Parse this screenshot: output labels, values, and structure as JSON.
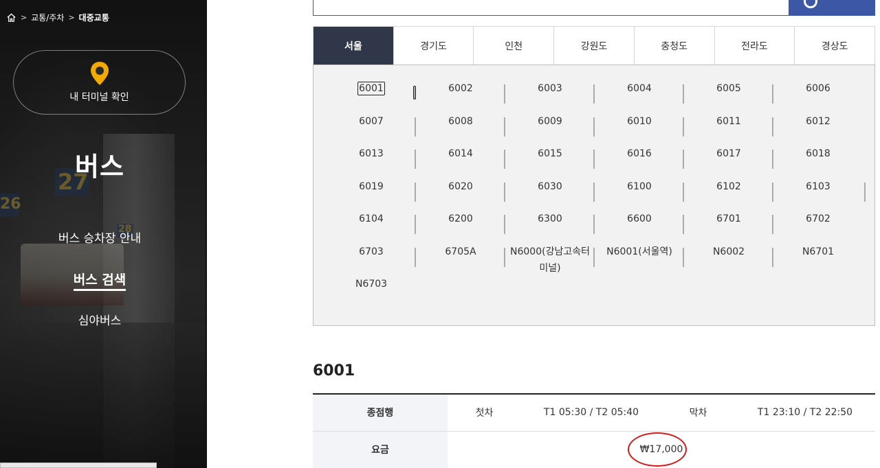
{
  "breadcrumb": {
    "items": [
      "교통/주차",
      "대중교통"
    ]
  },
  "sidebar": {
    "terminal_button_label": "내 터미널 확인",
    "title": "버스",
    "menu": [
      {
        "label": "버스 승차장 안내"
      },
      {
        "label": "버스 검색"
      },
      {
        "label": "심야버스"
      }
    ],
    "active_menu_index": 1
  },
  "region_tabs": [
    "서울",
    "경기도",
    "인천",
    "강원도",
    "충청도",
    "전라도",
    "경상도"
  ],
  "active_region": "서울",
  "routes": [
    "6001",
    "6002",
    "6003",
    "6004",
    "6005",
    "6006",
    "6007",
    "6008",
    "6009",
    "6010",
    "6011",
    "6012",
    "6013",
    "6014",
    "6015",
    "6016",
    "6017",
    "6018",
    "6019",
    "6020",
    "6030",
    "6100",
    "6102",
    "6103",
    "6104",
    "6200",
    "6300",
    "6600",
    "6701",
    "6702",
    "6703",
    "6705A",
    "N6000(강남고속터미널)",
    "N6001(서울역)",
    "N6002",
    "N6701",
    "N6703"
  ],
  "selected_route": "6001",
  "route_detail": {
    "heading": "6001",
    "row1": {
      "destination_label": "종점행",
      "first_bus_label": "첫차",
      "first_bus_time": "T1 05:30 / T2 05:40",
      "last_bus_label": "막차",
      "last_bus_time": "T1 23:10 / T2 22:50"
    },
    "row2": {
      "fare_label": "요금",
      "fare_value": "₩17,000"
    }
  },
  "colors": {
    "active_tab": "#2f3748",
    "search_button": "#3b57a6",
    "table_header_bg": "#f3f4f8",
    "highlight_circle": "#d61a1a",
    "pin_icon": "#f2a900"
  }
}
